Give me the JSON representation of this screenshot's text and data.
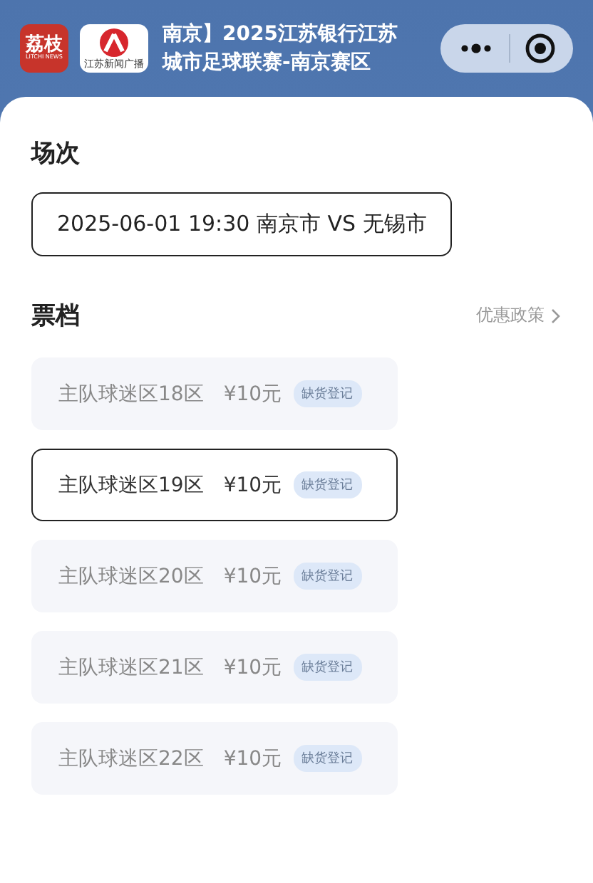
{
  "header": {
    "logos": [
      {
        "kind": "litchi",
        "text": "荔枝",
        "subtext": "LITCHI NEWS"
      },
      {
        "kind": "radio",
        "subtext": "江苏新闻广播"
      }
    ],
    "title_lines": [
      "南京】2025江苏银行江苏",
      "城市足球联赛-南京赛区"
    ]
  },
  "session": {
    "heading": "场次",
    "options": [
      {
        "label": "2025-06-01 19:30 南京市 VS 无锡市",
        "selected": true
      }
    ]
  },
  "tickets": {
    "heading": "票档",
    "link": "优惠政策",
    "items": [
      {
        "name": "主队球迷区18区",
        "price": "¥10元",
        "badge": "缺货登记",
        "selected": false
      },
      {
        "name": "主队球迷区19区",
        "price": "¥10元",
        "badge": "缺货登记",
        "selected": true
      },
      {
        "name": "主队球迷区20区",
        "price": "¥10元",
        "badge": "缺货登记",
        "selected": false
      },
      {
        "name": "主队球迷区21区",
        "price": "¥10元",
        "badge": "缺货登记",
        "selected": false
      },
      {
        "name": "主队球迷区22区",
        "price": "¥10元",
        "badge": "缺货登记",
        "selected": false
      }
    ]
  }
}
